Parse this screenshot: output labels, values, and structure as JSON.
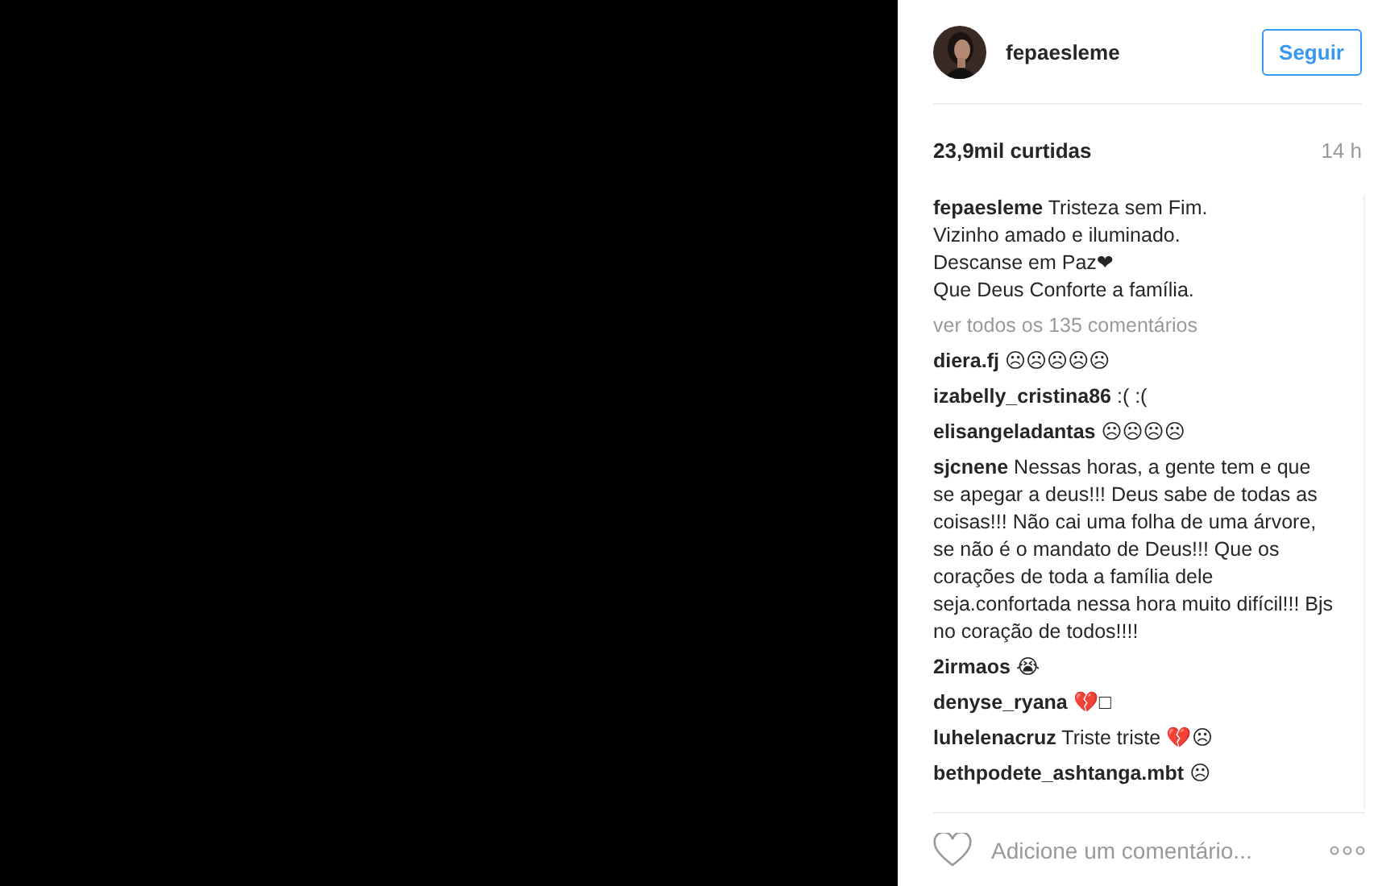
{
  "post": {
    "username": "fepaesleme",
    "follow_button": "Seguir",
    "likes": "23,9mil curtidas",
    "time": "14 h",
    "caption": {
      "username": "fepaesleme",
      "lines": [
        "Tristeza sem Fim.",
        "Vizinho amado e iluminado.",
        "Descanse em Paz❤",
        "Que Deus Conforte a família."
      ]
    },
    "view_all": "ver todos os 135 comentários",
    "comments": [
      {
        "username": "diera.fj",
        "text": "☹☹☹☹☹"
      },
      {
        "username": "izabelly_cristina86",
        "text": ":( :("
      },
      {
        "username": "elisangeladantas",
        "text": "☹☹☹☹"
      },
      {
        "username": "sjcnene",
        "text": "Nessas horas, a gente tem e que se apegar a deus!!! Deus sabe de todas as coisas!!! Não cai uma folha de uma árvore, se não é o mandato de Deus!!! Que os corações de toda a família dele seja.confortada nessa hora muito difícil!!! Bjs no coração de todos!!!!"
      },
      {
        "username": "2irmaos",
        "text": "😭"
      },
      {
        "username": "denyse_ryana",
        "text": "💔□"
      },
      {
        "username": "luhelenacruz",
        "text": "Triste triste 💔☹"
      },
      {
        "username": "bethpodete_ashtanga.mbt",
        "text": "☹"
      }
    ],
    "comment_placeholder": "Adicione um comentário..."
  }
}
